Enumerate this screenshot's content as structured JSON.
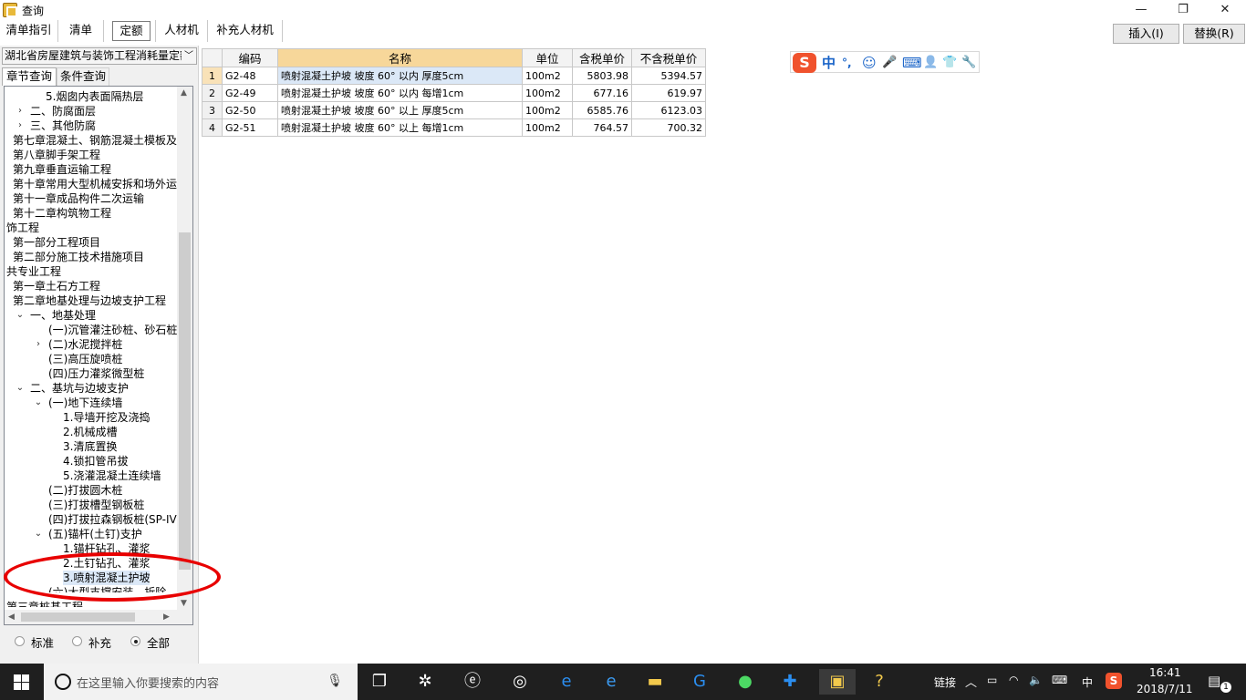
{
  "window": {
    "title": "查询",
    "minimize": "—",
    "maximize": "❐",
    "close": "✕"
  },
  "toolbar": {
    "tabs": [
      "清单指引",
      "清单",
      "定额",
      "人材机",
      "补充人材机"
    ],
    "active_tab": "定额",
    "insert_label": "插入(I)",
    "replace_label": "替换(R)"
  },
  "left": {
    "library": "湖北省房屋建筑与装饰工程消耗量定额",
    "tab_chapter": "章节查询",
    "tab_condition": "条件查询",
    "tree": [
      "5.烟囱内表面隔热层",
      "二、防腐面层",
      "三、其他防腐",
      "第七章混凝土、钢筋混凝土模板及",
      "第八章脚手架工程",
      "第九章垂直运输工程",
      "第十章常用大型机械安拆和场外运",
      "第十一章成品构件二次运输",
      "第十二章构筑物工程",
      "饰工程",
      "第一部分工程项目",
      "第二部分施工技术措施项目",
      "共专业工程",
      "第一章土石方工程",
      "第二章地基处理与边坡支护工程",
      "一、地基处理",
      "(一)沉管灌注砂桩、砂石桩",
      "(二)水泥搅拌桩",
      "(三)高压旋喷桩",
      "(四)压力灌浆微型桩",
      "二、基坑与边坡支护",
      "(一)地下连续墙",
      "1.导墙开挖及浇捣",
      "2.机械成槽",
      "3.清底置换",
      "4.锁扣管吊拔",
      "5.浇灌混凝土连续墙",
      "(二)打拔圆木桩",
      "(三)打拔槽型钢板桩",
      "(四)打拔拉森钢板桩(SP-IV",
      "(五)锚杆(土钉)支护",
      "1.锚杆钻孔、灌浆",
      "2.土钉钻孔、灌浆",
      "3.喷射混凝土护坡",
      "(六)大型支撑安装、拆除",
      "第三章桩基工程"
    ],
    "filter": {
      "standard": "标准",
      "supplement": "补充",
      "all": "全部"
    }
  },
  "grid": {
    "headers": [
      "编码",
      "名称",
      "单位",
      "含税单价",
      "不含税单价"
    ],
    "rows": [
      {
        "idx": "1",
        "code": "G2-48",
        "name": "喷射混凝土护坡 坡度 60° 以内 厚度5cm",
        "unit": "100m2",
        "price_tax": "5803.98",
        "price_notax": "5394.57"
      },
      {
        "idx": "2",
        "code": "G2-49",
        "name": "喷射混凝土护坡 坡度 60° 以内 每增1cm",
        "unit": "100m2",
        "price_tax": "677.16",
        "price_notax": "619.97"
      },
      {
        "idx": "3",
        "code": "G2-50",
        "name": "喷射混凝土护坡 坡度 60° 以上 厚度5cm",
        "unit": "100m2",
        "price_tax": "6585.76",
        "price_notax": "6123.03"
      },
      {
        "idx": "4",
        "code": "G2-51",
        "name": "喷射混凝土护坡 坡度 60° 以上 每增1cm",
        "unit": "100m2",
        "price_tax": "764.57",
        "price_notax": "700.32"
      }
    ]
  },
  "ime": {
    "logo": "S",
    "lang": "中",
    "punct": "°,",
    "emoji": "☺",
    "voice": "🎤",
    "keyboard": "⌨",
    "user": "👤",
    "skin": "👕",
    "tools": "🔧"
  },
  "taskbar": {
    "search_placeholder": "在这里输入你要搜索的内容",
    "links": "链接",
    "ime_lang": "中",
    "time": "16:41",
    "date": "2018/7/11",
    "notif_count": "1"
  }
}
